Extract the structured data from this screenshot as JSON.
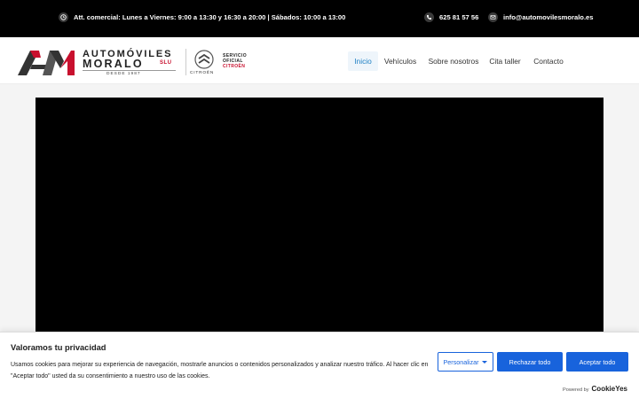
{
  "topbar": {
    "hours": "Att. comercial: Lunes a Viernes: 9:00 a 13:30 y 16:30 a 20:00 | Sábados: 10:00 a 13:00",
    "phone": "625 81 57 56",
    "email": "info@automovilesmoralo.es",
    "hours_icon": "clock-icon",
    "phone_icon": "phone-icon",
    "email_icon": "mail-icon"
  },
  "brand": {
    "line1": "AUTOMÓVILES",
    "line2": "MORALO",
    "suffix": "SLU",
    "since": "DESDE 1987",
    "partner_name": "CITROËN",
    "partner_tag": [
      "SERVICIO",
      "OFICIAL",
      "CITROËN"
    ]
  },
  "nav": {
    "items": [
      "Inicio",
      "Vehículos",
      "Sobre nosotros",
      "Cita taller",
      "Contacto"
    ],
    "active_index": 0
  },
  "cookie": {
    "title": "Valoramos tu privacidad",
    "text": "Usamos cookies para mejorar su experiencia de navegación, mostrarle anuncios o contenidos personalizados y analizar nuestro tráfico. Al hacer clic en \"Aceptar todo\" usted da su consentimiento a nuestro uso de las cookies.",
    "customize": "Personalizar",
    "reject": "Rechazar todo",
    "accept": "Aceptar todo",
    "powered_by": "Powered by",
    "provider": "CookieYes"
  },
  "colors": {
    "accent": "#1863dc",
    "brand_red": "#c8102e",
    "nav_active": "#1d7fc4"
  }
}
